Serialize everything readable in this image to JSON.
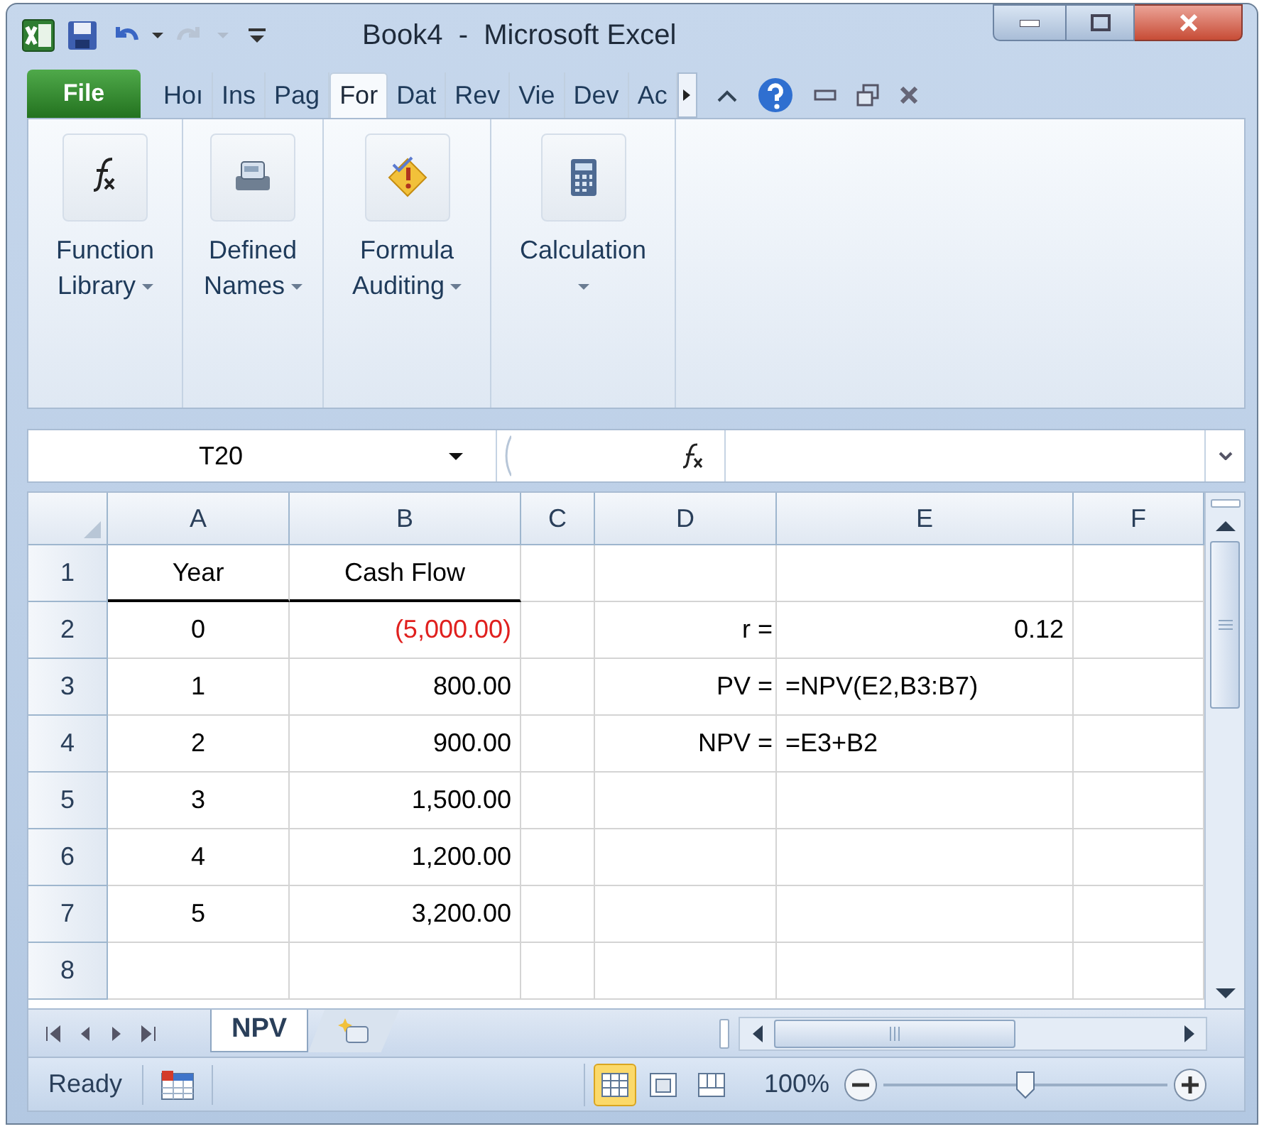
{
  "window": {
    "title": "Book4  -  Microsoft Excel"
  },
  "ribbon_tabs": [
    {
      "label": "File",
      "kind": "file",
      "selected": false
    },
    {
      "label": "Hoı",
      "kind": "tab",
      "selected": false
    },
    {
      "label": "Ins",
      "kind": "tab",
      "selected": false
    },
    {
      "label": "Pag",
      "kind": "tab",
      "selected": false
    },
    {
      "label": "For",
      "kind": "tab",
      "selected": true
    },
    {
      "label": "Dat",
      "kind": "tab",
      "selected": false
    },
    {
      "label": "Rev",
      "kind": "tab",
      "selected": false
    },
    {
      "label": "Vie",
      "kind": "tab",
      "selected": false
    },
    {
      "label": "Dev",
      "kind": "tab",
      "selected": false
    },
    {
      "label": "Ac",
      "kind": "tab",
      "selected": false
    }
  ],
  "ribbon_groups": [
    {
      "label": "Function Library",
      "kind": "function"
    },
    {
      "label": "Defined Names",
      "kind": "names"
    },
    {
      "label": "Formula Auditing",
      "kind": "auditing"
    },
    {
      "label": "Calculation",
      "kind": "calculation"
    }
  ],
  "formula_bar": {
    "name_box": "T20"
  },
  "columns": [
    "A",
    "B",
    "C",
    "D",
    "E",
    "F"
  ],
  "rows": [
    {
      "header": "1",
      "cells": {
        "A": {
          "text": "Year",
          "kind": "heading"
        },
        "B": {
          "text": "Cash Flow",
          "kind": "heading"
        }
      }
    },
    {
      "header": "2",
      "cells": {
        "A": {
          "text": "0",
          "kind": "index"
        },
        "B": {
          "text": "(5,000.00)",
          "kind": "negative"
        },
        "D": {
          "text": "r =",
          "kind": "label"
        },
        "E": {
          "text": "0.12",
          "kind": "number"
        }
      }
    },
    {
      "header": "3",
      "cells": {
        "A": {
          "text": "1",
          "kind": "index"
        },
        "B": {
          "text": "800.00",
          "kind": "number"
        },
        "D": {
          "text": "PV =",
          "kind": "label"
        },
        "E": {
          "text": "=NPV(E2,B3:B7)",
          "kind": "text"
        }
      }
    },
    {
      "header": "4",
      "cells": {
        "A": {
          "text": "2",
          "kind": "index"
        },
        "B": {
          "text": "900.00",
          "kind": "number"
        },
        "D": {
          "text": "NPV =",
          "kind": "label"
        },
        "E": {
          "text": "=E3+B2",
          "kind": "text"
        }
      }
    },
    {
      "header": "5",
      "cells": {
        "A": {
          "text": "3",
          "kind": "index"
        },
        "B": {
          "text": "1,500.00",
          "kind": "number"
        }
      }
    },
    {
      "header": "6",
      "cells": {
        "A": {
          "text": "4",
          "kind": "index"
        },
        "B": {
          "text": "1,200.00",
          "kind": "number"
        }
      }
    },
    {
      "header": "7",
      "cells": {
        "A": {
          "text": "5",
          "kind": "index"
        },
        "B": {
          "text": "3,200.00",
          "kind": "number"
        }
      }
    },
    {
      "header": "8"
    }
  ],
  "sheet_tabs": [
    {
      "label": "NPV",
      "selected": true
    }
  ],
  "status_bar": {
    "status": "Ready",
    "view_buttons": [
      {
        "kind": "normal",
        "selected": true
      },
      {
        "kind": "layout",
        "selected": false
      },
      {
        "kind": "break",
        "selected": false
      }
    ],
    "zoom": "100%",
    "zoom_slider": {
      "level": 0.5
    }
  }
}
